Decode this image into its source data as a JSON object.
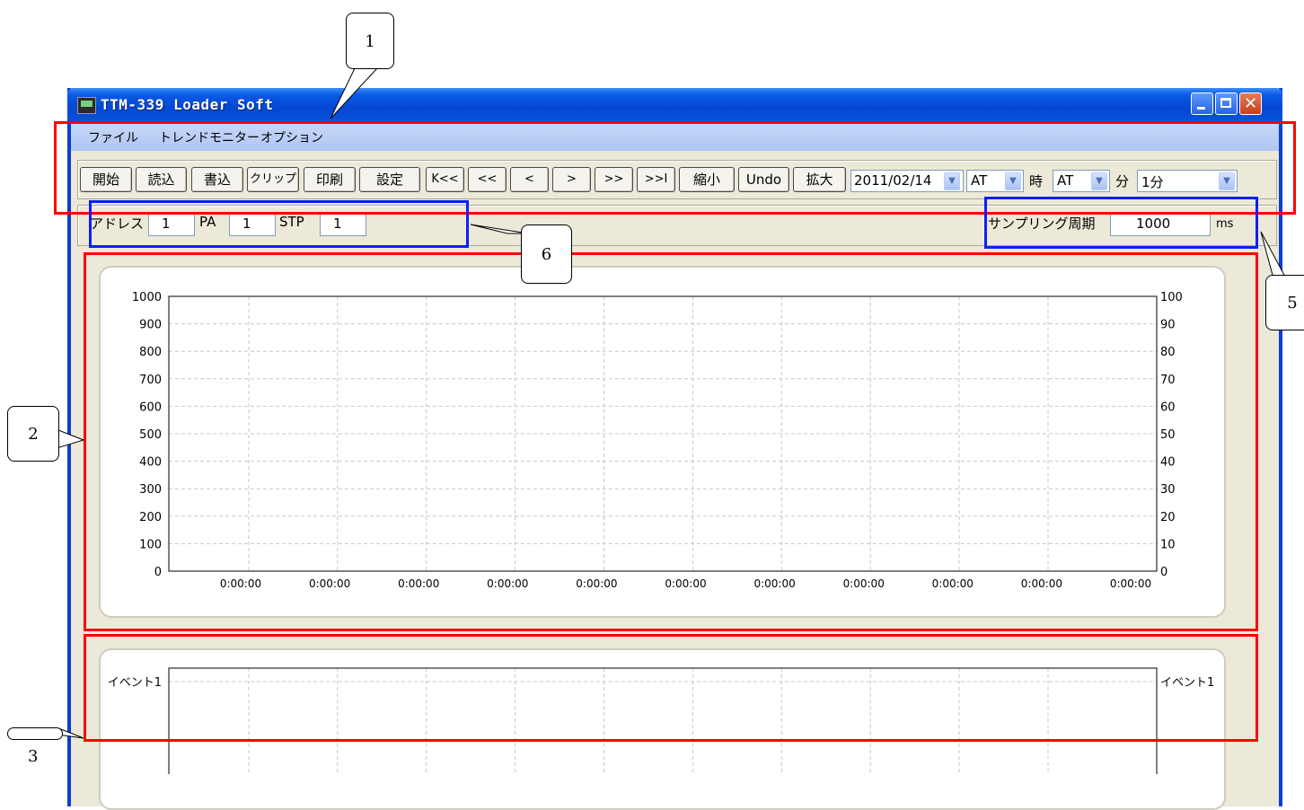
{
  "window": {
    "title": "TTM-339 Loader Soft"
  },
  "menu": {
    "items": [
      "ファイル",
      "トレンドモニター",
      "オプション"
    ]
  },
  "toolbar": {
    "buttons": [
      "開始",
      "読込",
      "書込",
      "クリップ",
      "印刷",
      "設定",
      "K<<",
      "<<",
      "<",
      ">",
      ">>",
      ">>I",
      "縮小",
      "Undo",
      "拡大"
    ],
    "date_value": "2011/02/14",
    "hour_value": "AT",
    "hour_label": "時",
    "minute_value": "AT",
    "minute_label": "分",
    "interval_value": "1分"
  },
  "params": {
    "address_label": "アドレス",
    "address_value": "1",
    "pa_label": "PA",
    "pa_value": "1",
    "stp_label": "STP",
    "stp_value": "1",
    "sampling_label": "サンプリング周期",
    "sampling_value": "1000",
    "sampling_unit": "ms"
  },
  "chart_data": [
    {
      "type": "line",
      "series": [],
      "y_left_ticks": [
        "1000",
        "900",
        "800",
        "700",
        "600",
        "500",
        "400",
        "300",
        "200",
        "100",
        "0"
      ],
      "y_right_ticks": [
        "100",
        "90",
        "80",
        "70",
        "60",
        "50",
        "40",
        "30",
        "20",
        "10",
        "0"
      ],
      "ylim_left": [
        0,
        1000
      ],
      "ylim_right": [
        0,
        100
      ],
      "x_ticks": [
        "0:00:00",
        "0:00:00",
        "0:00:00",
        "0:00:00",
        "0:00:00",
        "0:00:00",
        "0:00:00",
        "0:00:00",
        "0:00:00",
        "0:00:00",
        "0:00:00"
      ],
      "grid": true
    },
    {
      "type": "line",
      "series": [],
      "y_left_ticks": [
        "イベント1"
      ],
      "y_right_ticks": [
        "イベント1"
      ],
      "grid": true
    }
  ],
  "annotations": {
    "callouts": [
      "1",
      "2",
      "3",
      "5",
      "6"
    ]
  },
  "colors": {
    "title_bar": "#0a52dc",
    "menu_bar": "#b9cff4",
    "highlight_red": "#ff0000",
    "highlight_blue": "#0a1eff"
  }
}
